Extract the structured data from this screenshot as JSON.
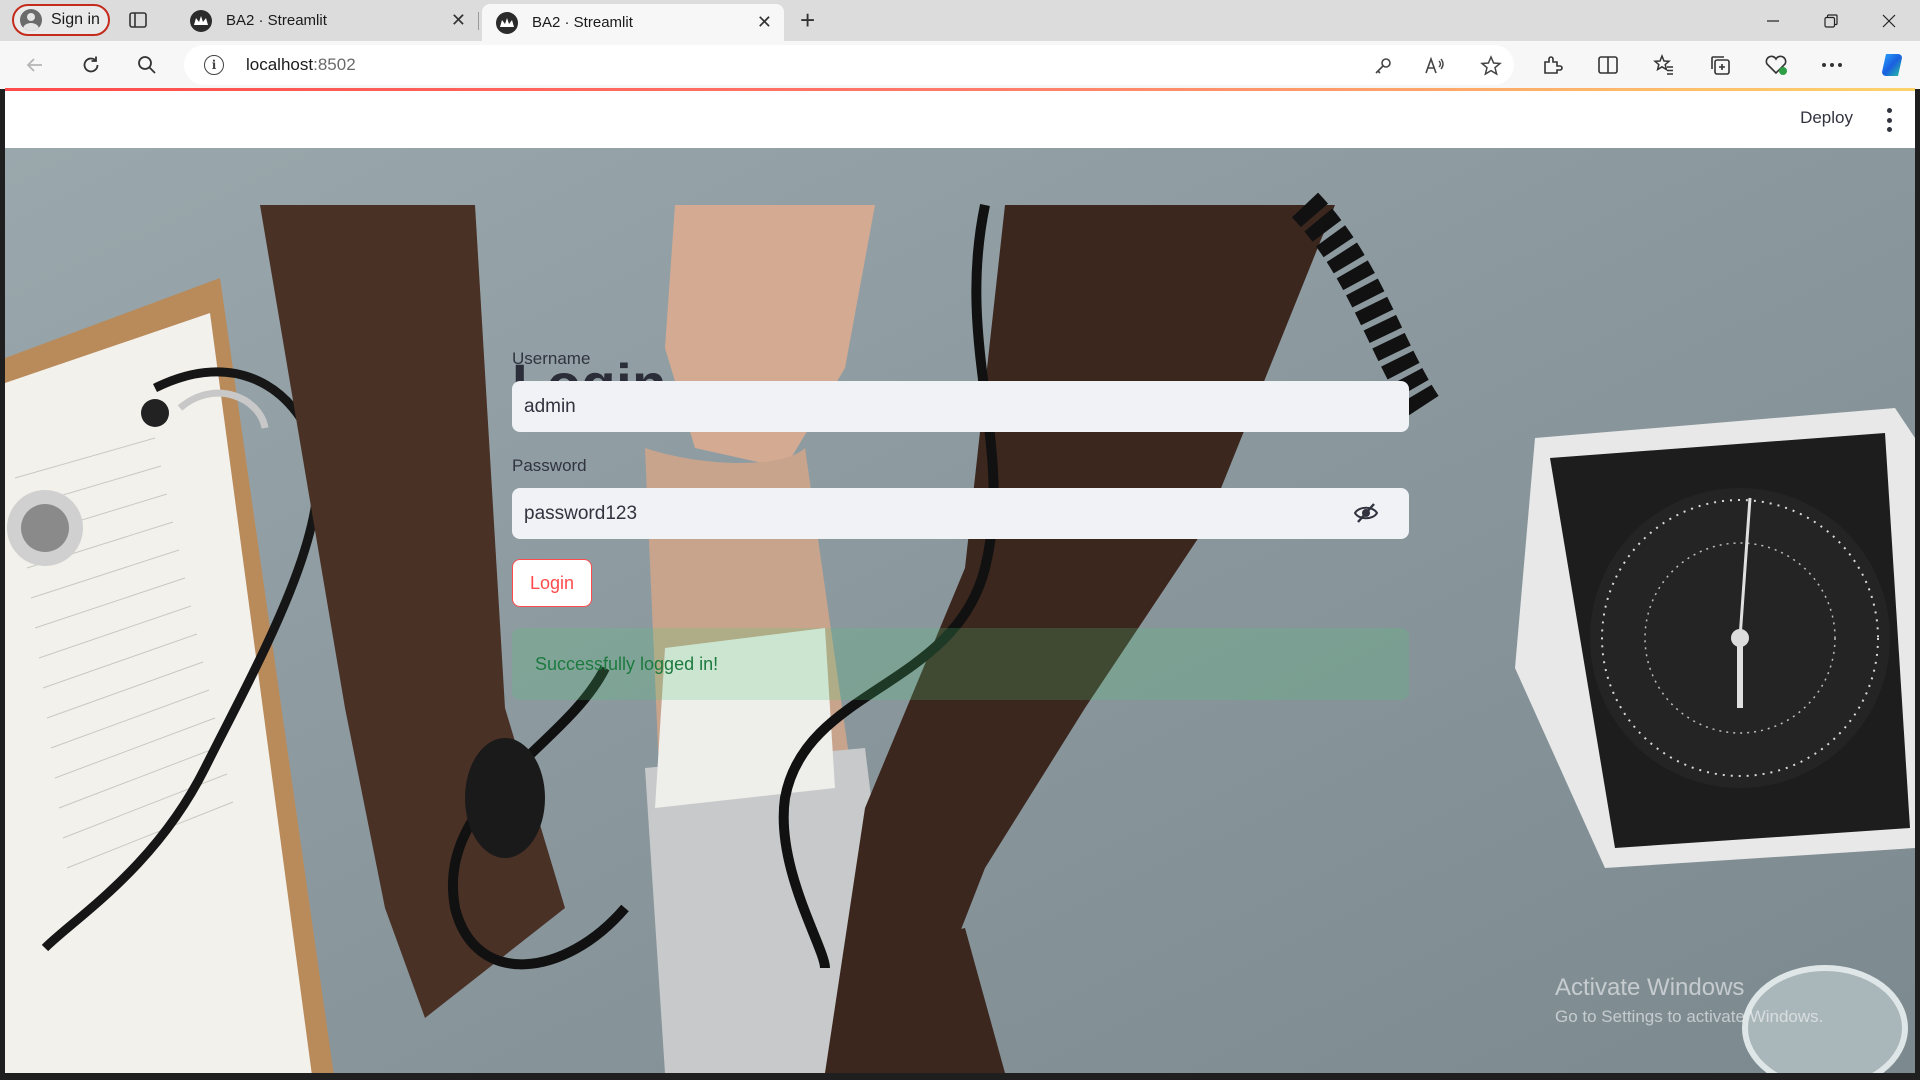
{
  "browser": {
    "profile_label": "Sign in",
    "tabs": [
      {
        "title": "BA2 · Streamlit",
        "active": false
      },
      {
        "title": "BA2 · Streamlit",
        "active": true
      }
    ],
    "address": {
      "host": "localhost",
      "port": ":8502"
    }
  },
  "header": {
    "deploy_label": "Deploy"
  },
  "login": {
    "title": "Login",
    "username_label": "Username",
    "username_value": "admin",
    "password_label": "Password",
    "password_value": "password123",
    "button_label": "Login",
    "success_message": "Successfully logged in!"
  },
  "watermark": {
    "line1": "Activate Windows",
    "line2": "Go to Settings to activate Windows."
  },
  "colors": {
    "accent": "#ff4b4b",
    "success_text": "#1c7a3f",
    "input_bg": "#f0f2f6"
  }
}
